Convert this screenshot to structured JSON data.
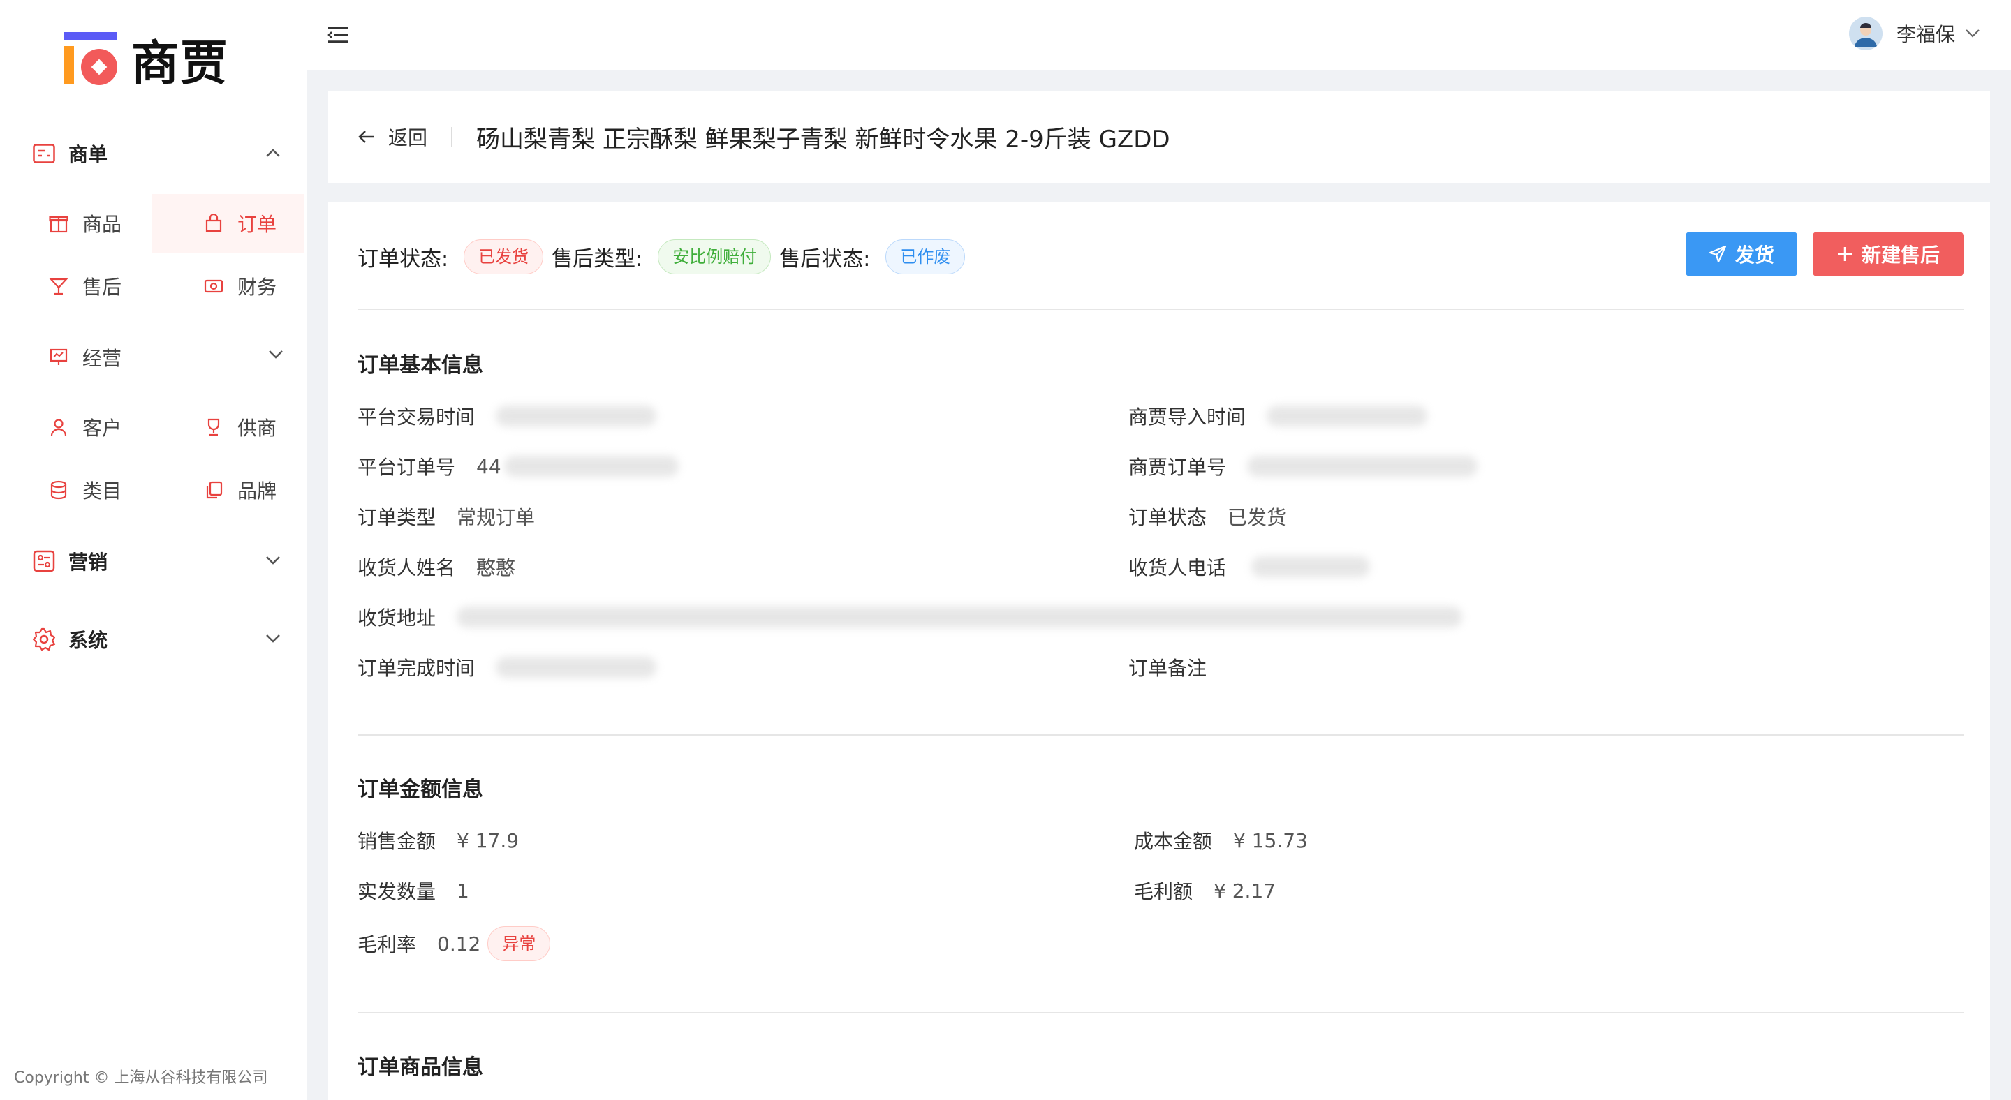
{
  "brand": {
    "name": "商贾"
  },
  "sidebar": {
    "groups": [
      {
        "label": "商单",
        "expanded": true
      },
      {
        "label": "营销",
        "expanded": false
      },
      {
        "label": "系统",
        "expanded": false
      }
    ],
    "items": [
      {
        "label": "商品"
      },
      {
        "label": "订单",
        "active": true
      },
      {
        "label": "售后"
      },
      {
        "label": "财务"
      },
      {
        "label": "经营"
      },
      {
        "label": "客户"
      },
      {
        "label": "供商"
      },
      {
        "label": "类目"
      },
      {
        "label": "品牌"
      }
    ],
    "copyright": "Copyright © 上海从谷科技有限公司"
  },
  "header": {
    "user_name": "李福保"
  },
  "title_bar": {
    "back_label": "返回",
    "title": "砀山梨青梨 正宗酥梨 鲜果梨子青梨 新鲜时令水果 2-9斤装 GZDD"
  },
  "status": {
    "order_status_label": "订单状态:",
    "order_status_value": "已发货",
    "after_type_label": "售后类型:",
    "after_type_value": "安比例赔付",
    "after_status_label": "售后状态:",
    "after_status_value": "已作废"
  },
  "actions": {
    "ship_label": "发货",
    "new_after_label": "新建售后"
  },
  "basic_info": {
    "title": "订单基本信息",
    "platform_trade_time_label": "平台交易时间",
    "import_time_label": "商贾导入时间",
    "platform_order_no_label": "平台订单号",
    "platform_order_no_prefix": "44",
    "shangjia_order_no_label": "商贾订单号",
    "order_type_label": "订单类型",
    "order_type_value": "常规订单",
    "order_status_label": "订单状态",
    "order_status_value": "已发货",
    "receiver_name_label": "收货人姓名",
    "receiver_name_value": "憨憨",
    "receiver_phone_label": "收货人电话",
    "address_label": "收货地址",
    "complete_time_label": "订单完成时间",
    "remark_label": "订单备注"
  },
  "amount_info": {
    "title": "订单金额信息",
    "sales_amount_label": "销售金额",
    "sales_amount_value": "¥ 17.9",
    "cost_amount_label": "成本金额",
    "cost_amount_value": "¥ 15.73",
    "quantity_label": "实发数量",
    "quantity_value": "1",
    "gross_profit_label": "毛利额",
    "gross_profit_value": "¥ 2.17",
    "gross_margin_label": "毛利率",
    "gross_margin_value": "0.12",
    "gross_margin_tag": "异常"
  },
  "goods_info": {
    "title": "订单商品信息"
  },
  "colors": {
    "accent_red": "#e8423f",
    "ship_button": "#3a98f4",
    "after_button": "#f15e5e",
    "tag_green": "#3fae3a",
    "tag_blue": "#2e8ef0"
  }
}
